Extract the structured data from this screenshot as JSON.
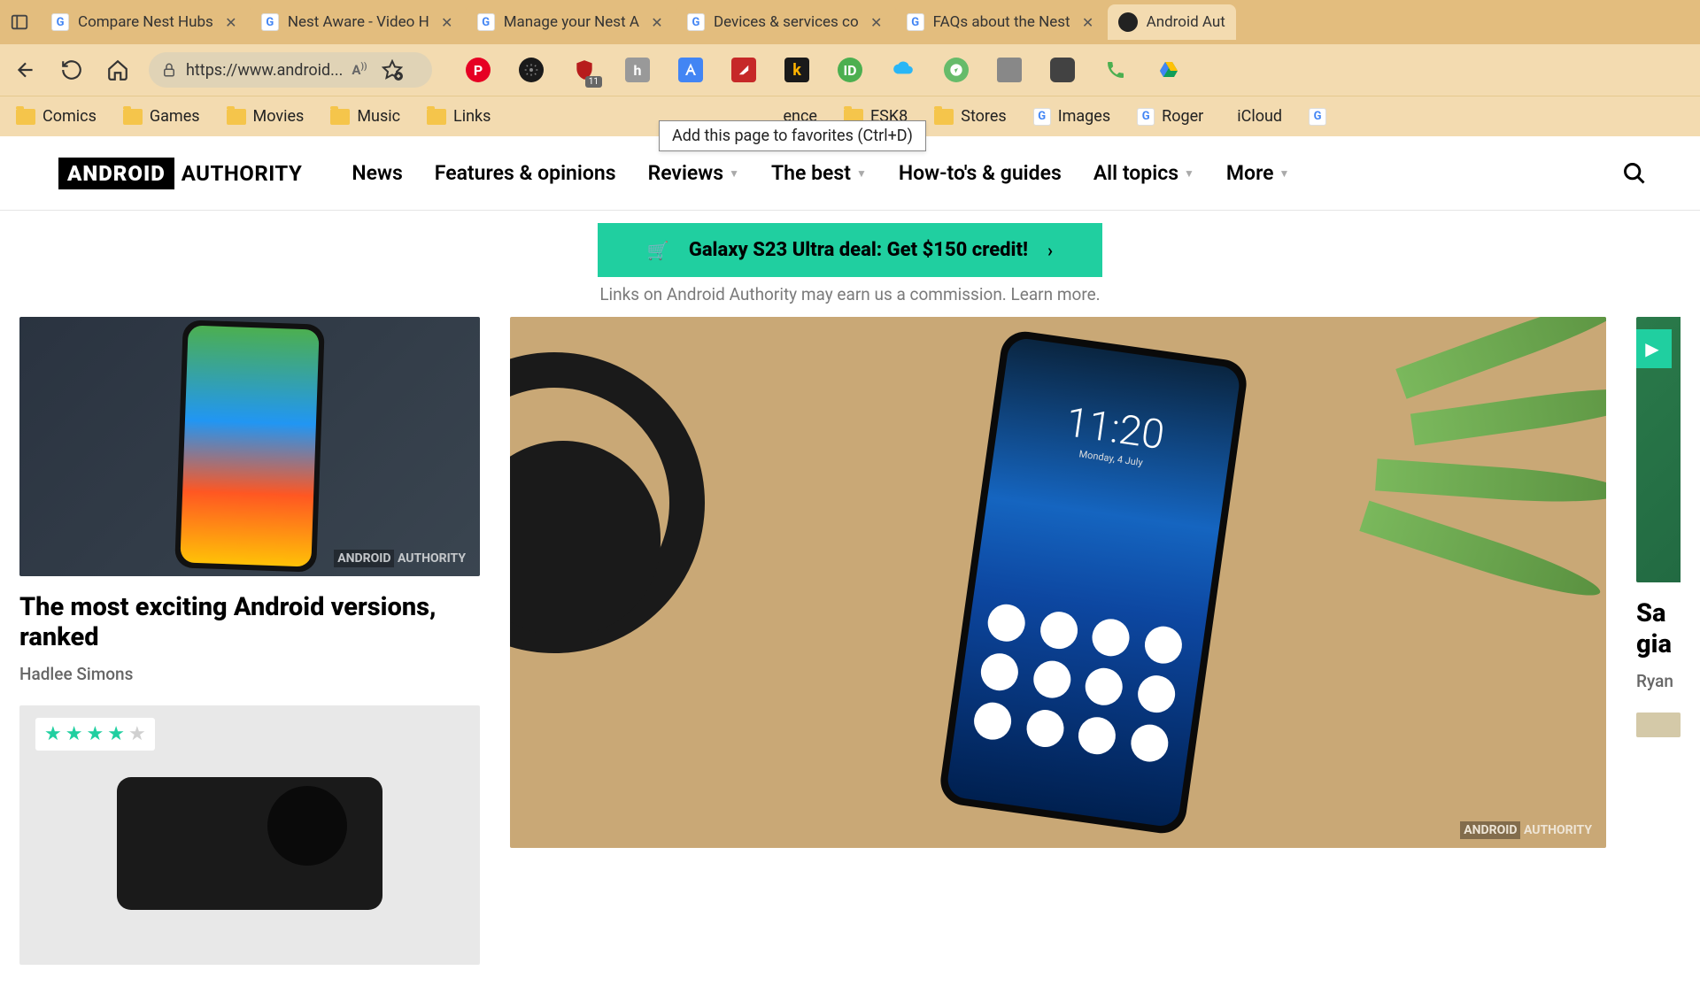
{
  "tabs": [
    {
      "title": "Compare Nest Hubs",
      "favicon": "g"
    },
    {
      "title": "Nest Aware - Video H",
      "favicon": "g"
    },
    {
      "title": "Manage your Nest A",
      "favicon": "g"
    },
    {
      "title": "Devices & services co",
      "favicon": "g"
    },
    {
      "title": "FAQs about the Nest",
      "favicon": "g"
    },
    {
      "title": "Android Aut",
      "favicon": "aa",
      "active": true
    }
  ],
  "address_bar": {
    "url": "https://www.android..."
  },
  "tooltip": "Add this page to favorites (Ctrl+D)",
  "extensions": {
    "shield_badge": "11"
  },
  "bookmarks": [
    {
      "label": "Comics",
      "type": "folder"
    },
    {
      "label": "Games",
      "type": "folder"
    },
    {
      "label": "Movies",
      "type": "folder"
    },
    {
      "label": "Music",
      "type": "folder"
    },
    {
      "label": "Links",
      "type": "folder"
    },
    {
      "label": "ence",
      "type": "folder_partial"
    },
    {
      "label": "ESK8",
      "type": "folder"
    },
    {
      "label": "Stores",
      "type": "folder"
    },
    {
      "label": "Images",
      "type": "g"
    },
    {
      "label": "Roger",
      "type": "g"
    },
    {
      "label": "iCloud",
      "type": "apple"
    }
  ],
  "site": {
    "logo_box": "ANDROID",
    "logo_text": "AUTHORITY",
    "nav": [
      "News",
      "Features & opinions",
      "Reviews",
      "The best",
      "How-to's & guides",
      "All topics",
      "More"
    ],
    "nav_caret": [
      false,
      false,
      true,
      true,
      false,
      true,
      true
    ],
    "deal": "Galaxy S23 Ultra deal: Get $150 credit!",
    "commission_text": "Links on Android Authority may earn us a commission. ",
    "commission_link": "Learn more.",
    "cards": {
      "left1": {
        "title": "The most exciting Android versions, ranked",
        "author": "Hadlee Simons"
      },
      "right1": {
        "title": "Sa",
        "title2": "gia",
        "author": "Ryan"
      }
    },
    "phone2": {
      "time": "11:20",
      "date": "Monday, 4 July"
    },
    "watermark_box": "ANDROID",
    "watermark_text": "AUTHORITY"
  }
}
